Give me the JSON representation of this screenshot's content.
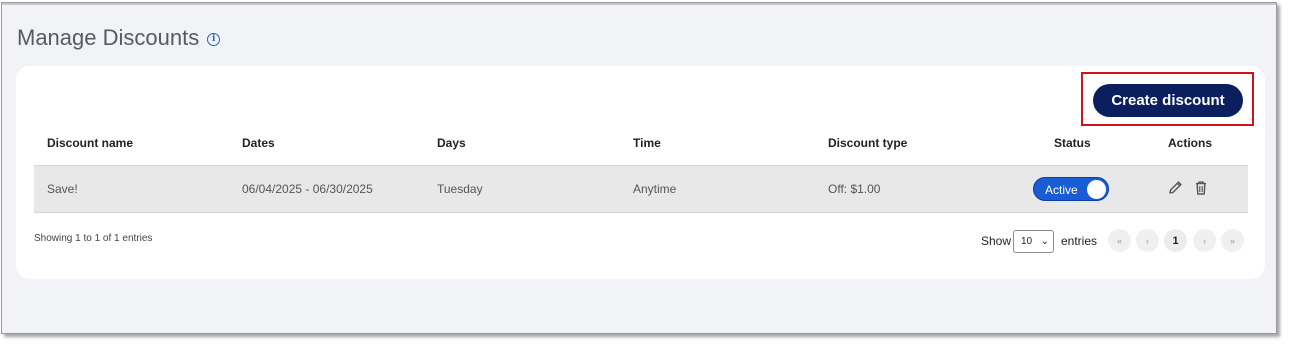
{
  "page": {
    "title": "Manage Discounts",
    "info_icon": "i"
  },
  "toolbar": {
    "create_label": "Create discount"
  },
  "table": {
    "headers": [
      "Discount name",
      "Dates",
      "Days",
      "Time",
      "Discount type",
      "Status",
      "Actions"
    ],
    "rows": [
      {
        "name": "Save!",
        "dates": "06/04/2025 - 06/30/2025",
        "days": "Tuesday",
        "time": "Anytime",
        "discount_type": "Off: $1.00",
        "status": "Active",
        "status_on": true
      }
    ]
  },
  "footer": {
    "showing": "Showing 1 to 1 of 1 entries",
    "show_label": "Show",
    "page_size": "10",
    "entries_label": "entries",
    "pagination": {
      "first": "«",
      "prev": "‹",
      "current": "1",
      "next": "›",
      "last": "»"
    }
  },
  "colors": {
    "primary_button": "#0b1f5e",
    "toggle_active": "#1a5bd6",
    "highlight": "#d0141c"
  }
}
